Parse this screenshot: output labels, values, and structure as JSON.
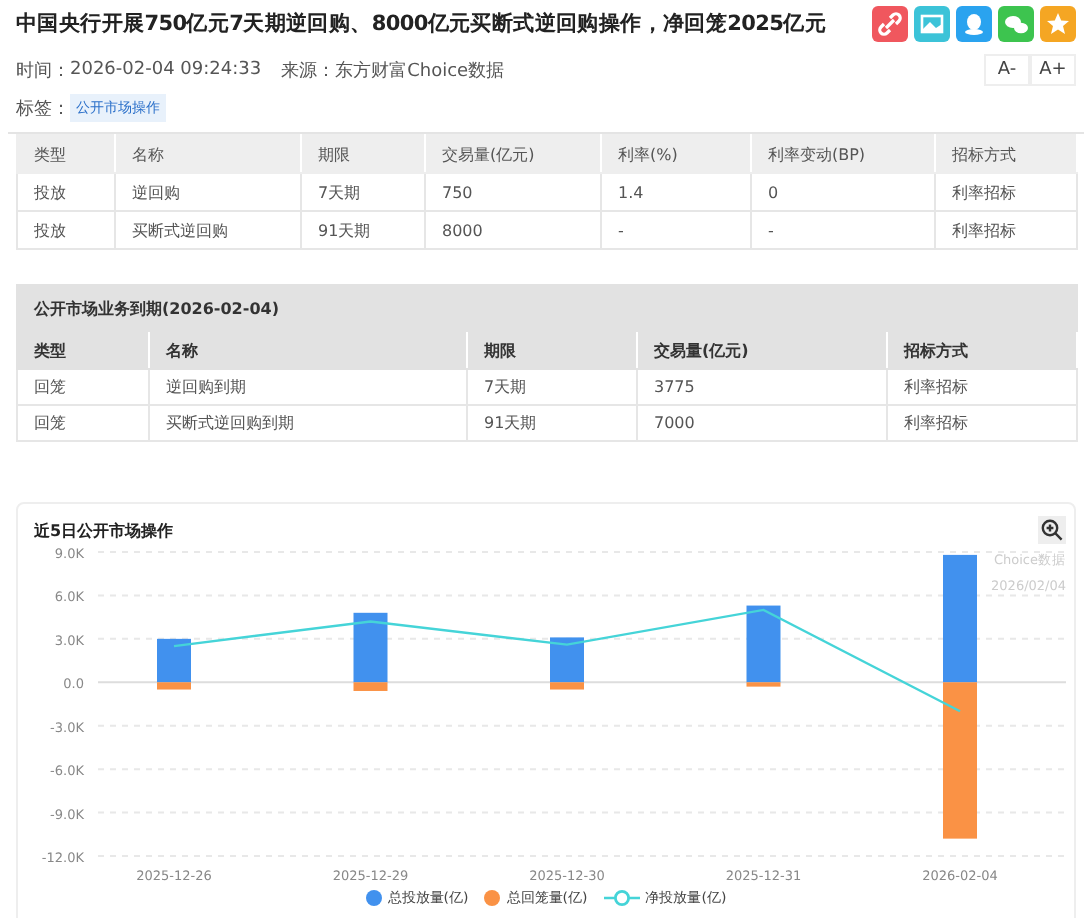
{
  "article": {
    "title": "中国央行开展750亿元7天期逆回购、8000亿元买断式逆回购操作，净回笼2025亿元",
    "time_label": "时间：",
    "time": "2026-02-04 09:24:33",
    "source_label": "来源：",
    "source": "东方财富Choice数据",
    "tags_label": "标签：",
    "tags": [
      "公开市场操作"
    ],
    "font_buttons": [
      "A-",
      "A+"
    ],
    "share_icons": [
      {
        "kind": "link",
        "color": "#f0575e"
      },
      {
        "kind": "picture",
        "color": "#3cc3d8"
      },
      {
        "kind": "qq",
        "color": "#2aa3ef"
      },
      {
        "kind": "wechat",
        "color": "#3dc44f"
      },
      {
        "kind": "star",
        "color": "#f5a623"
      }
    ]
  },
  "operations_table": {
    "columns": [
      "类型",
      "名称",
      "期限",
      "交易量(亿元)",
      "利率(%)",
      "利率变动(BP)",
      "招标方式"
    ],
    "rows": [
      [
        "投放",
        "逆回购",
        "7天期",
        "750",
        "1.4",
        "0",
        "利率招标"
      ],
      [
        "投放",
        "买断式逆回购",
        "91天期",
        "8000",
        "-",
        "-",
        "利率招标"
      ]
    ]
  },
  "maturity_table": {
    "title": "公开市场业务到期(2026-02-04)",
    "columns": [
      "类型",
      "名称",
      "期限",
      "交易量(亿元)",
      "招标方式"
    ],
    "rows": [
      [
        "回笼",
        "逆回购到期",
        "7天期",
        "3775",
        "利率招标"
      ],
      [
        "回笼",
        "买断式逆回购到期",
        "91天期",
        "7000",
        "利率招标"
      ]
    ]
  },
  "chart_card": {
    "title": "近5日公开市场操作",
    "chart_data": {
      "type": "bar",
      "stacked": true,
      "grid": true,
      "categories": [
        "2025-12-26",
        "2025-12-29",
        "2025-12-30",
        "2025-12-31",
        "2026-02-04"
      ],
      "ylim": [
        -12000,
        9000
      ],
      "yticks": [
        {
          "value": 9000,
          "label": "9.0K"
        },
        {
          "value": 6000,
          "label": "6.0K"
        },
        {
          "value": 3000,
          "label": "3.0K"
        },
        {
          "value": 0,
          "label": "0.0"
        },
        {
          "value": -3000,
          "label": "-3.0K"
        },
        {
          "value": -6000,
          "label": "-6.0K"
        },
        {
          "value": -9000,
          "label": "-9.0K"
        },
        {
          "value": -12000,
          "label": "-12.0K"
        }
      ],
      "series": [
        {
          "name": "总投放量(亿)",
          "color": "#4191ee",
          "values": [
            3000,
            4800,
            3100,
            5300,
            8800
          ]
        },
        {
          "name": "总回笼量(亿)",
          "color": "#fa9245",
          "values": [
            -500,
            -600,
            -500,
            -300,
            -10800
          ]
        },
        {
          "name": "净投放量(亿)",
          "color": "#45d4d8",
          "type": "line",
          "values": [
            2500,
            4200,
            2600,
            5000,
            -2000
          ]
        }
      ],
      "annotations": [
        "Choice数据",
        "2026/02/04"
      ]
    }
  }
}
